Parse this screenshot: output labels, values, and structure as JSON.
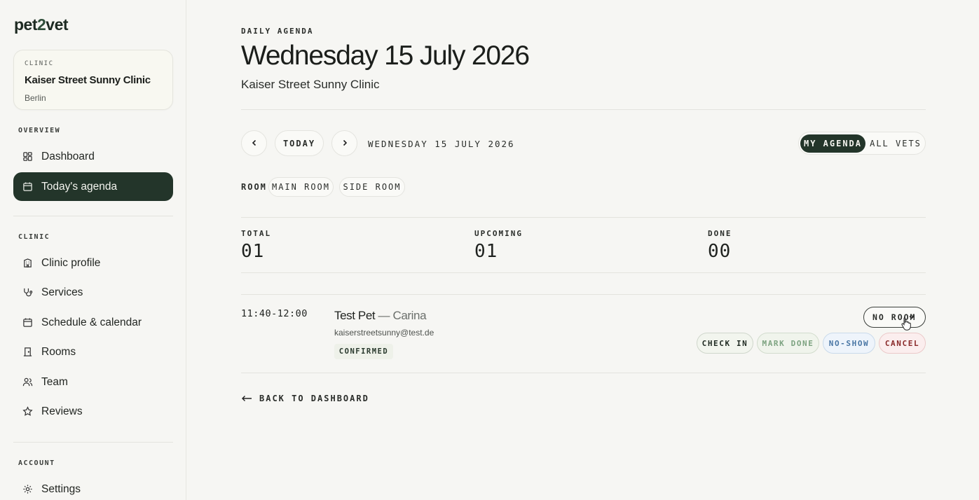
{
  "brand": {
    "logo_a": "pet",
    "logo_b": "2",
    "logo_c": "vet"
  },
  "clinic_card": {
    "label": "CLINIC",
    "name": "Kaiser Street Sunny Clinic",
    "city": "Berlin"
  },
  "sidebar": {
    "overview_label": "OVERVIEW",
    "clinic_label": "CLINIC",
    "account_label": "ACCOUNT",
    "items": [
      {
        "label": "Dashboard",
        "icon": "dashboard-icon"
      },
      {
        "label": "Today's agenda",
        "icon": "calendar-icon",
        "active": true
      },
      {
        "label": "Clinic profile",
        "icon": "building-icon"
      },
      {
        "label": "Services",
        "icon": "stethoscope-icon"
      },
      {
        "label": "Schedule & calendar",
        "icon": "calendar-icon"
      },
      {
        "label": "Rooms",
        "icon": "door-icon"
      },
      {
        "label": "Team",
        "icon": "users-icon"
      },
      {
        "label": "Reviews",
        "icon": "star-icon"
      },
      {
        "label": "Settings",
        "icon": "gear-icon"
      }
    ]
  },
  "header": {
    "eyebrow": "DAILY AGENDA",
    "title": "Wednesday 15 July 2026",
    "subtitle": "Kaiser Street Sunny Clinic"
  },
  "date_nav": {
    "today_label": "TODAY",
    "date_label": "WEDNESDAY 15 JULY 2026"
  },
  "view_toggle": {
    "my_agenda": "MY AGENDA",
    "all_vets": "ALL VETS",
    "selected": "MY AGENDA"
  },
  "room_filter": {
    "label": "ROOM",
    "options": [
      "MAIN ROOM",
      "SIDE ROOM"
    ]
  },
  "stats": [
    {
      "label": "TOTAL",
      "value": "01"
    },
    {
      "label": "UPCOMING",
      "value": "01"
    },
    {
      "label": "DONE",
      "value": "00"
    }
  ],
  "appointment": {
    "time": "11:40-12:00",
    "pet": "Test Pet",
    "separator": "—",
    "owner": "Carina",
    "email": "kaiserstreetsunny@test.de",
    "status": "CONFIRMED",
    "room_select": "NO ROOM",
    "actions": {
      "check_in": "CHECK IN",
      "mark_done": "MARK DONE",
      "no_show": "NO-SHOW",
      "cancel": "CANCEL"
    }
  },
  "back_link": "BACK TO DASHBOARD",
  "colors": {
    "accent_dark": "#23352a",
    "page_bg": "#f6f6f3",
    "cancel": "#8a2a2a",
    "no_show": "#4a77a5",
    "mark_done": "#7da381"
  }
}
